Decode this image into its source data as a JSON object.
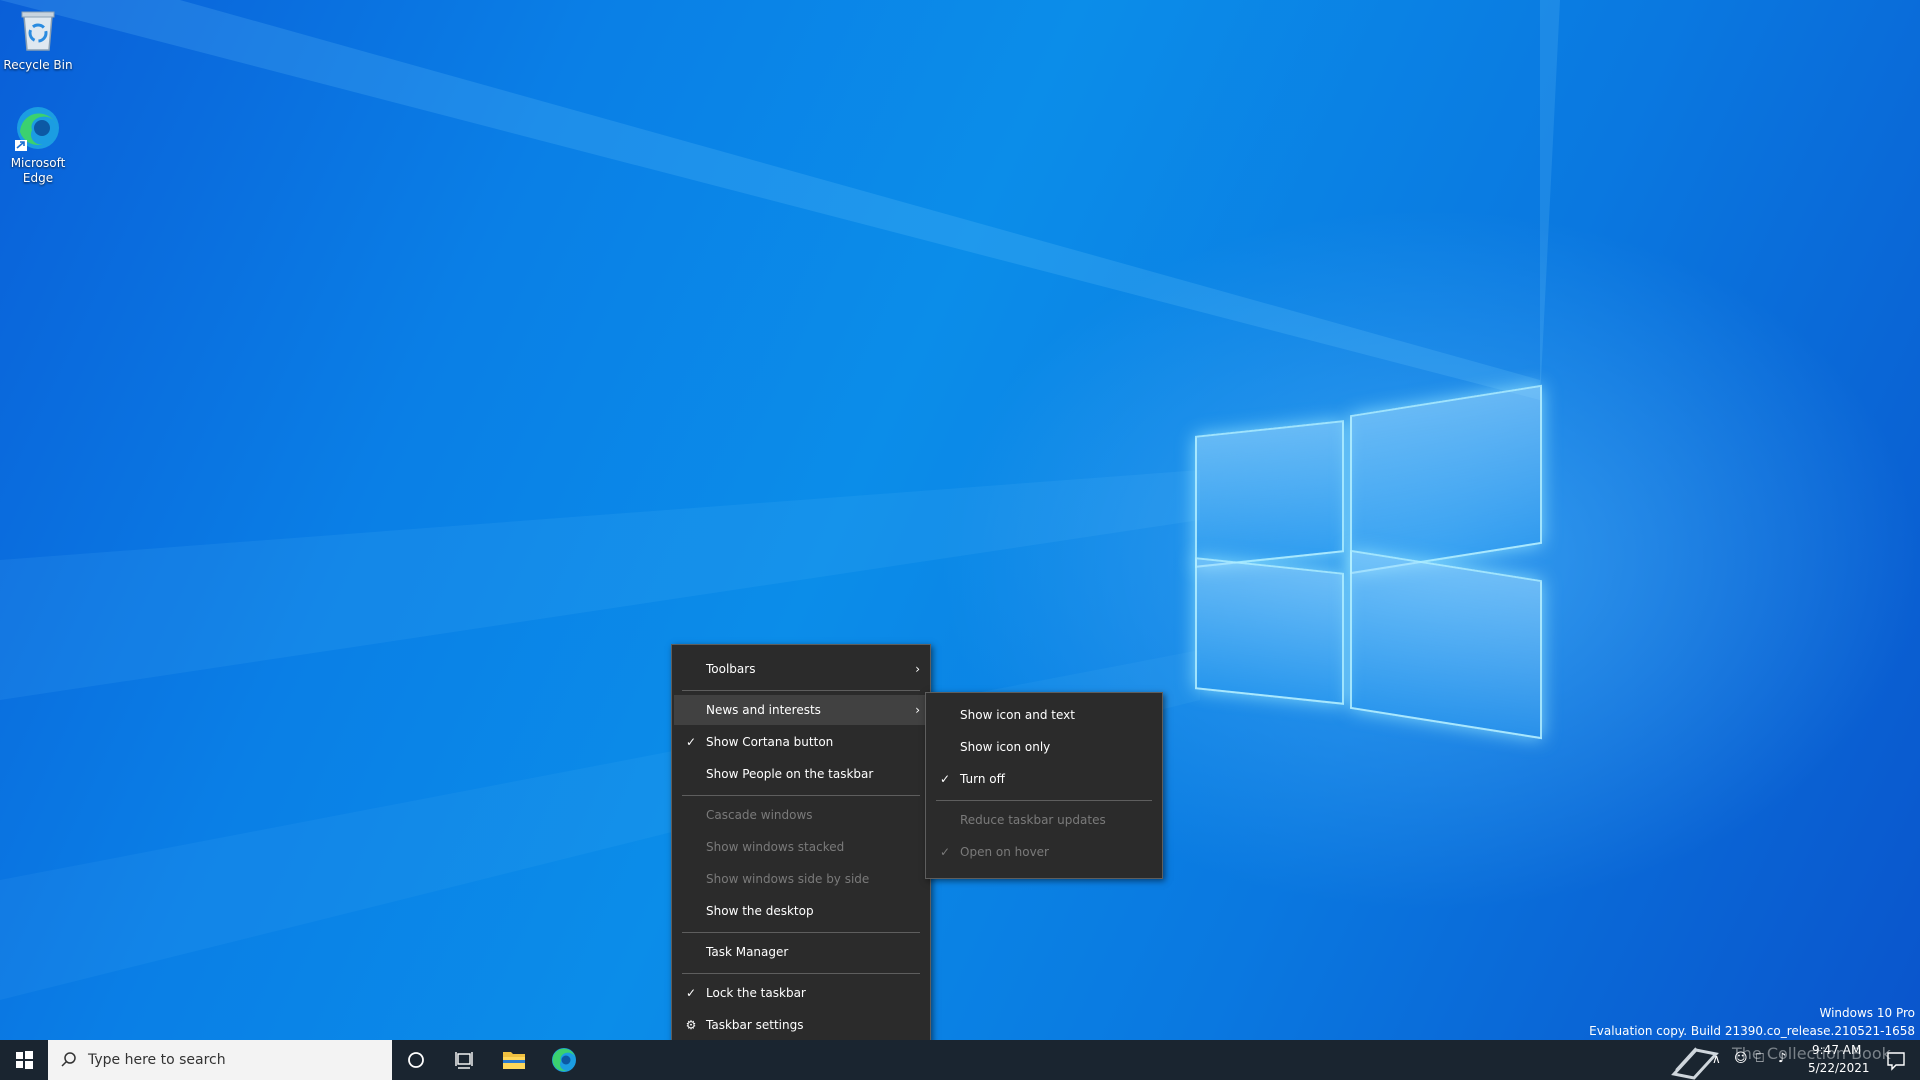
{
  "desktop": {
    "icons": [
      {
        "label": "Recycle Bin"
      },
      {
        "label": "Microsoft\nEdge"
      }
    ],
    "watermark": {
      "edition": "Windows 10 Pro",
      "build": "Evaluation copy. Build 21390.co_release.210521-1658"
    }
  },
  "context_menu": {
    "items": [
      {
        "label": "Toolbars",
        "submenu": true
      },
      {
        "label": "News and interests",
        "submenu": true,
        "highlighted": true
      },
      {
        "label": "Show Cortana button",
        "checked": true
      },
      {
        "label": "Show People on the taskbar"
      },
      {
        "label": "Cascade windows",
        "disabled": true
      },
      {
        "label": "Show windows stacked",
        "disabled": true
      },
      {
        "label": "Show windows side by side",
        "disabled": true
      },
      {
        "label": "Show the desktop"
      },
      {
        "label": "Task Manager"
      },
      {
        "label": "Lock the taskbar",
        "checked": true
      },
      {
        "label": "Taskbar settings",
        "icon": "gear-icon"
      }
    ]
  },
  "news_submenu": {
    "items": [
      {
        "label": "Show icon and text"
      },
      {
        "label": "Show icon only"
      },
      {
        "label": "Turn off",
        "checked": true
      },
      {
        "label": "Reduce taskbar updates",
        "disabled": true
      },
      {
        "label": "Open on hover",
        "disabled": true,
        "checked": true
      }
    ]
  },
  "taskbar": {
    "search_placeholder": "Type here to search",
    "clock_time": "9:47 AM",
    "clock_date": "5/22/2021",
    "overlay_text": "The Collection Book"
  },
  "colors": {
    "menu_bg": "#2b2b2b",
    "menu_hover": "#414141",
    "taskbar_bg": "#1a2530",
    "desktop_blue": "#0a7fe6"
  }
}
